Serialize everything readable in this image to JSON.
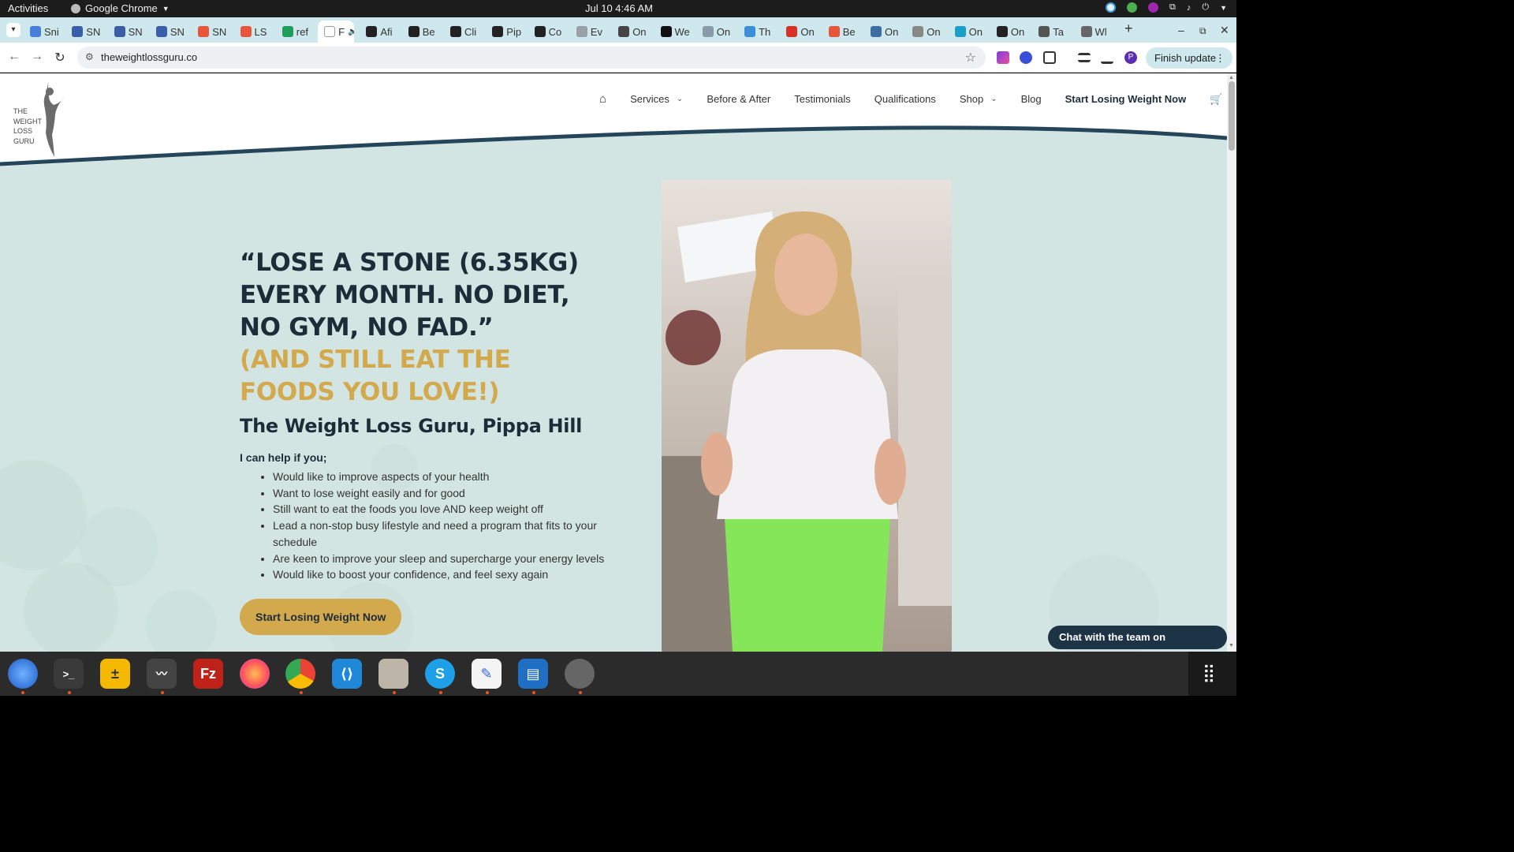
{
  "topbar": {
    "activities": "Activities",
    "app_name": "Google Chrome",
    "clock": "Jul 10  4:46 AM"
  },
  "tabs": [
    {
      "label": "Sni",
      "color": "#4a7fd9"
    },
    {
      "label": "SN",
      "color": "#3a5fa8"
    },
    {
      "label": "SN",
      "color": "#3a5fa8"
    },
    {
      "label": "SN",
      "color": "#3a5fa8"
    },
    {
      "label": "SN",
      "color": "#e8553a"
    },
    {
      "label": "LS",
      "color": "#e8553a"
    },
    {
      "label": "ref",
      "color": "#1e9e5a"
    },
    {
      "label": "F",
      "color": "#ffffff",
      "active": true
    },
    {
      "label": "Afi",
      "color": "#222222"
    },
    {
      "label": "Be",
      "color": "#222222"
    },
    {
      "label": "Cli",
      "color": "#222222"
    },
    {
      "label": "Pip",
      "color": "#222222"
    },
    {
      "label": "Co",
      "color": "#222222"
    },
    {
      "label": "Ev",
      "color": "#9aa0a6"
    },
    {
      "label": "On",
      "color": "#444444"
    },
    {
      "label": "We",
      "color": "#111111"
    },
    {
      "label": "On",
      "color": "#8899aa"
    },
    {
      "label": "Th",
      "color": "#3b8fd8"
    },
    {
      "label": "On",
      "color": "#d93025"
    },
    {
      "label": "Be",
      "color": "#e8553a"
    },
    {
      "label": "On",
      "color": "#3a6ea5"
    },
    {
      "label": "On",
      "color": "#888888"
    },
    {
      "label": "On",
      "color": "#18a0c8"
    },
    {
      "label": "On",
      "color": "#222222"
    },
    {
      "label": "Ta",
      "color": "#555555"
    },
    {
      "label": "Wl",
      "color": "#666666"
    }
  ],
  "toolbar": {
    "url": "theweightlossguru.co",
    "finish_update": "Finish update",
    "profile_initial": "P"
  },
  "site": {
    "logo_lines": [
      "THE",
      "WEIGHT",
      "LOSS",
      "GURU"
    ],
    "nav": {
      "services": "Services",
      "before_after": "Before & After",
      "testimonials": "Testimonials",
      "qualifications": "Qualifications",
      "shop": "Shop",
      "blog": "Blog",
      "cta": "Start Losing Weight Now"
    },
    "hero": {
      "quote": "“LOSE A STONE (6.35KG) EVERY MONTH. NO DIET, NO GYM, NO FAD.”",
      "subquote": "(AND STILL EAT THE FOODS YOU LOVE!)",
      "name": "The Weight Loss Guru, Pippa Hill",
      "intro": "I can help if you;",
      "bullets": [
        "Would like to improve aspects of your health",
        "Want to lose weight easily and for good",
        "Still want to eat the foods you love AND keep weight off",
        "Lead a non-stop busy lifestyle and need a program that fits to your schedule",
        "Are keen to improve your sleep and supercharge your energy levels",
        "Would like to boost your confidence, and feel sexy again"
      ],
      "cta": "Start Losing Weight Now"
    },
    "whatsapp": "Chat with the team on Whatsapp"
  },
  "colors": {
    "accent_gold": "#d3a94e",
    "navy": "#1d2c38",
    "page_bg": "#d3e5e2"
  }
}
